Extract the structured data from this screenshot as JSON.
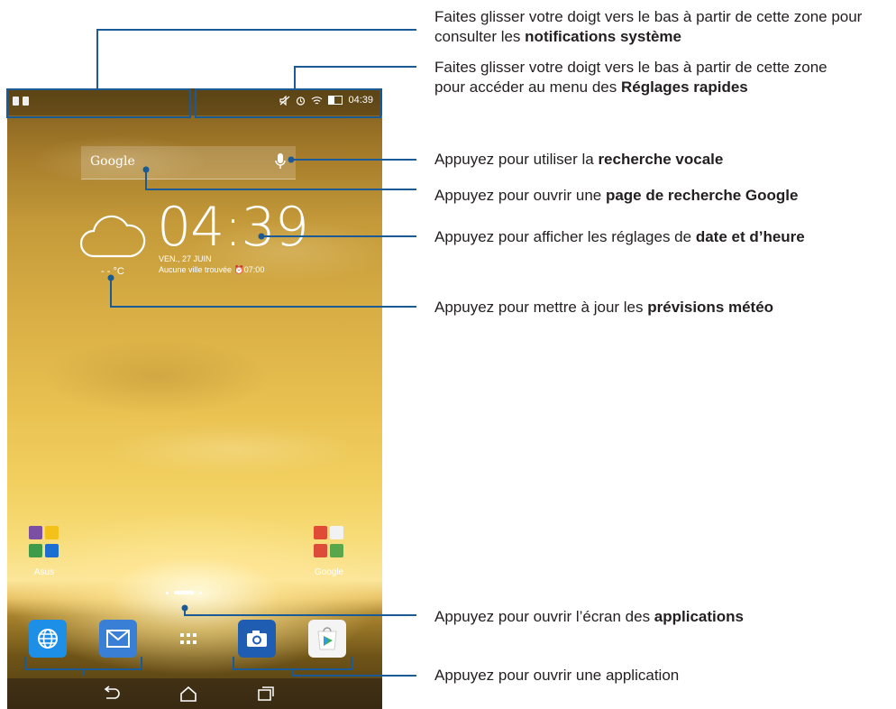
{
  "status_bar": {
    "time": "04:39"
  },
  "search_widget": {
    "logo_text": "Google"
  },
  "clock_widget": {
    "time": "04:39",
    "date": "VEN., 27 JUIN",
    "location_status": "Aucune ville trouvée",
    "alarm": "07:00",
    "temperature": "- - °C"
  },
  "folders": {
    "asus": "Asus",
    "google": "Google"
  },
  "dock": {
    "browser": "globe-icon",
    "email": "envelope-icon",
    "apps": "app-grid-icon",
    "camera": "camera-icon",
    "play_store": "play-store-icon"
  },
  "annotations": {
    "notifications": {
      "text": "Faites glisser votre doigt vers le bas à partir de cette zone pour consulter les ",
      "bold": "notifications système"
    },
    "quick_settings": {
      "text": "Faites glisser votre doigt vers le bas à partir de cette zone au menu des ",
      "text_exact": "Faites glisser votre doigt vers le bas à partir de cette zone pour accéder au menu des ",
      "bold": "Réglages rapides"
    },
    "voice_search": {
      "text": "Appuyez pour utiliser la ",
      "bold": "recherche vocale"
    },
    "google_search": {
      "text": "Appuyez pour ouvrir une ",
      "bold": "page de recherche Google"
    },
    "date_time": {
      "text": "Appuyez pour afficher les réglages de ",
      "bold": "date et d’heure"
    },
    "weather": {
      "text": "Appuyez pour mettre à jour les ",
      "bold": "prévisions météo"
    },
    "apps_screen": {
      "text": "Appuyez pour ouvrir l’écran des ",
      "bold": "applications"
    },
    "open_app": {
      "text": "Appuyez pour ouvrir une application",
      "bold": ""
    }
  },
  "colors": {
    "callout_line": "#1a5a96",
    "text": "#231f20"
  }
}
